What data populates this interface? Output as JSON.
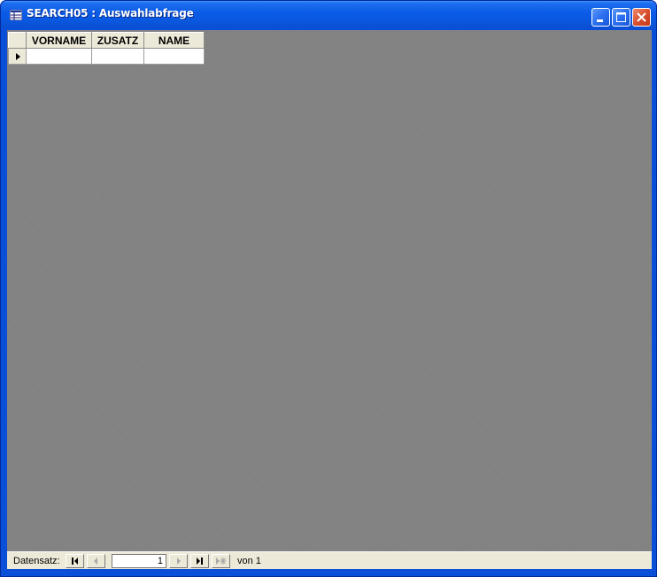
{
  "window": {
    "title": "SEARCH05 : Auswahlabfrage"
  },
  "datasheet": {
    "columns": [
      "VORNAME",
      "ZUSATZ",
      "NAME"
    ],
    "rows": [
      [
        "",
        "",
        ""
      ]
    ]
  },
  "navigation": {
    "label": "Datensatz:",
    "current_record": "1",
    "total_label": "von 1"
  },
  "colors": {
    "titlebar": "#0a5be6",
    "client_background": "#808080",
    "panel": "#ece9d8"
  },
  "icons": [
    "query-icon",
    "minimize-icon",
    "maximize-icon",
    "close-icon",
    "row-selector-arrow-icon",
    "first-record-icon",
    "previous-record-icon",
    "next-record-icon",
    "last-record-icon",
    "new-record-icon"
  ]
}
